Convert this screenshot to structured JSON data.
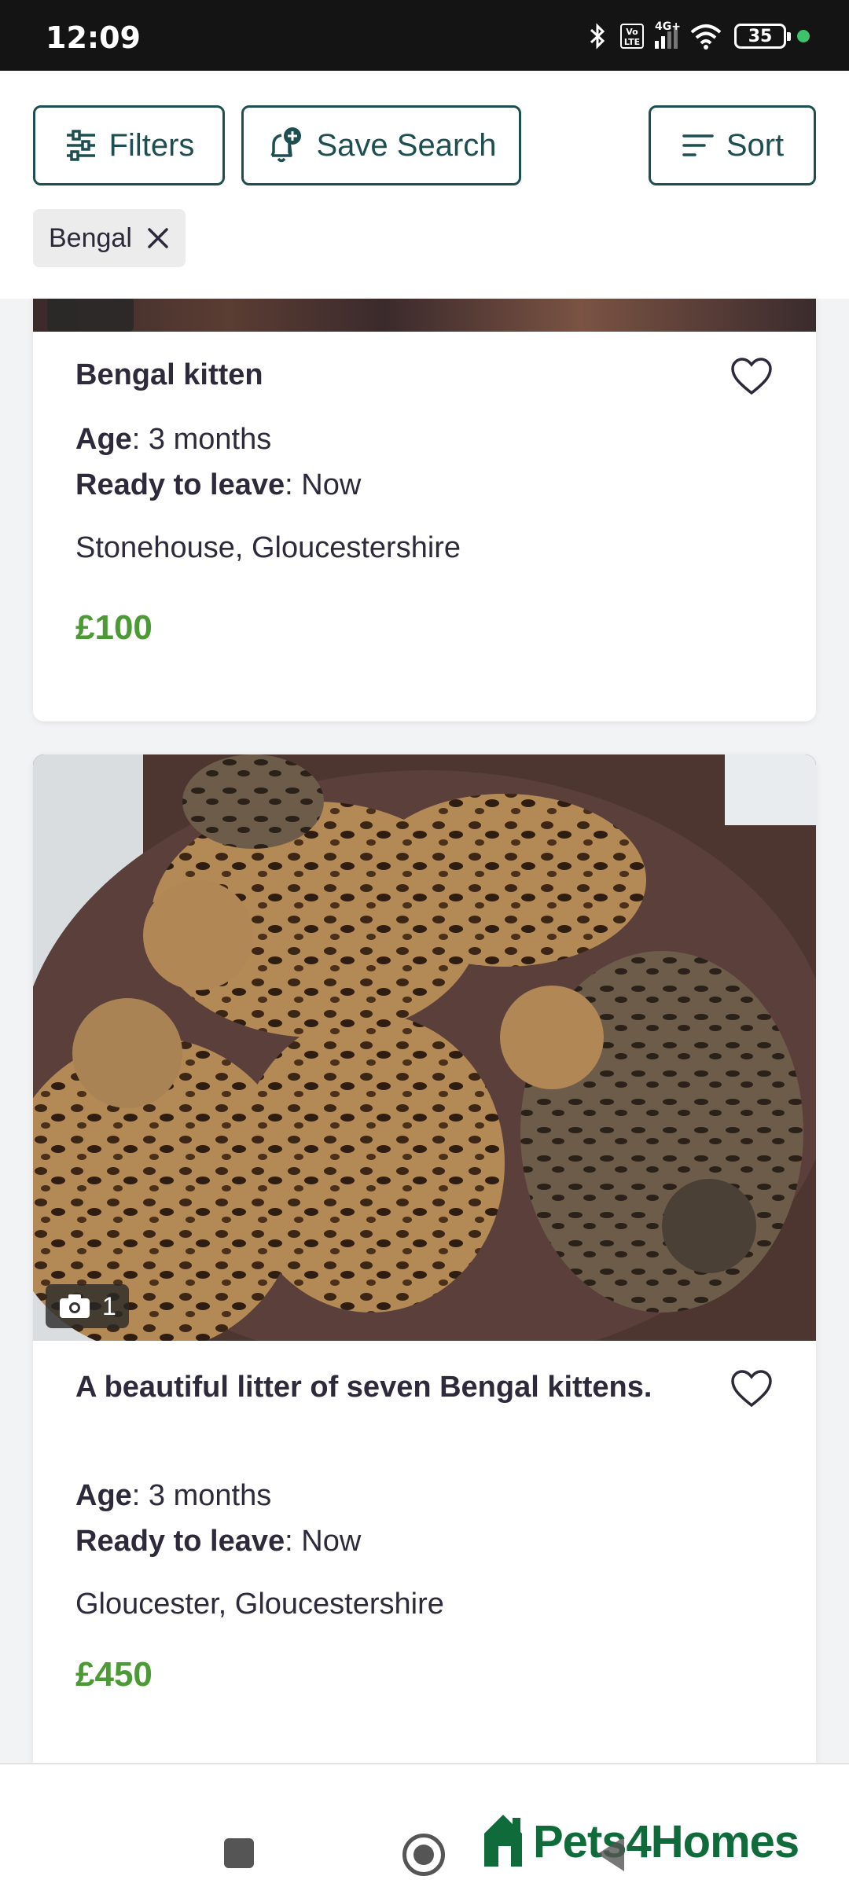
{
  "status_bar": {
    "time": "12:09",
    "battery": "35",
    "network": "4G+",
    "volte": "Vo LTE"
  },
  "toolbar": {
    "filters_label": "Filters",
    "save_search_label": "Save Search",
    "sort_label": "Sort"
  },
  "active_filters": [
    {
      "label": "Bengal"
    }
  ],
  "listings": [
    {
      "title": "Bengal kitten",
      "age_label": "Age",
      "age_value": ": 3 months",
      "ready_label": "Ready to leave",
      "ready_value": ": Now",
      "location": "Stonehouse, Gloucestershire",
      "price": "£100"
    },
    {
      "title": "A beautiful litter of seven Bengal kittens.",
      "photo_count": "1",
      "age_label": "Age",
      "age_value": ": 3 months",
      "ready_label": "Ready to leave",
      "ready_value": ": Now",
      "location": "Gloucester, Gloucestershire",
      "price": "£450"
    }
  ],
  "brand": {
    "name": "Pets4Homes",
    "color": "#0f6b3a"
  },
  "colors": {
    "accent_teal": "#1d4e52",
    "price_green": "#4c9a35"
  }
}
